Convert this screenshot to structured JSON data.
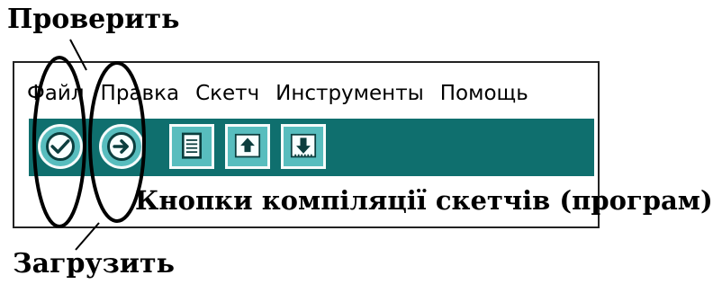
{
  "callouts": {
    "verify": "Проверить",
    "upload": "Загрузить",
    "compile_buttons": "Кнопки компіляції скетчів (програм)"
  },
  "menu": {
    "items": [
      "Файл",
      "Правка",
      "Скетч",
      "Инструменты",
      "Помощь"
    ]
  },
  "toolbar": {
    "buttons": [
      {
        "name": "verify",
        "icon": "check-icon"
      },
      {
        "name": "upload",
        "icon": "arrow-right-icon"
      },
      {
        "name": "new",
        "icon": "document-icon"
      },
      {
        "name": "open",
        "icon": "arrow-up-icon"
      },
      {
        "name": "save",
        "icon": "arrow-down-icon"
      }
    ],
    "color": "#0f6f6e",
    "button_color": "#58bdbe"
  }
}
